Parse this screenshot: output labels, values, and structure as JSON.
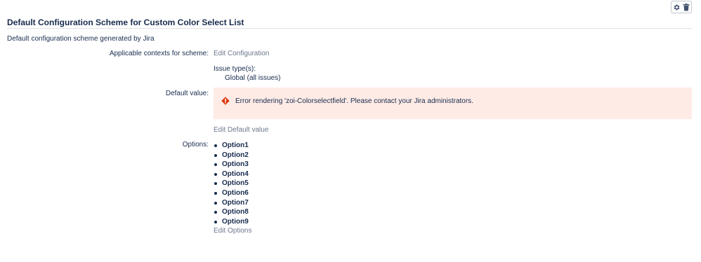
{
  "header": {
    "title": "Default Configuration Scheme for Custom Color Select List"
  },
  "toolbar": {
    "actions_icon": "gear-icon",
    "delete_icon": "trash-icon"
  },
  "description": "Default configuration scheme generated by Jira",
  "contexts": {
    "label": "Applicable contexts for scheme:",
    "edit_link": "Edit Configuration",
    "issue_types_label": "Issue type(s):",
    "issue_types_value": "Global (all issues)"
  },
  "default_value": {
    "label": "Default value:",
    "error_message": "Error rendering 'zoi-Colorselectfield'. Please contact your Jira administrators.",
    "edit_link": "Edit Default value"
  },
  "options": {
    "label": "Options:",
    "items": [
      "Option1",
      "Option2",
      "Option3",
      "Option4",
      "Option5",
      "Option6",
      "Option7",
      "Option8",
      "Option9"
    ],
    "edit_link": "Edit Options"
  },
  "colors": {
    "error_background": "#ffebe6",
    "error_icon": "#de350b",
    "text": "#172b4d",
    "link": "#6b778c",
    "rule": "#dfe1e6"
  }
}
